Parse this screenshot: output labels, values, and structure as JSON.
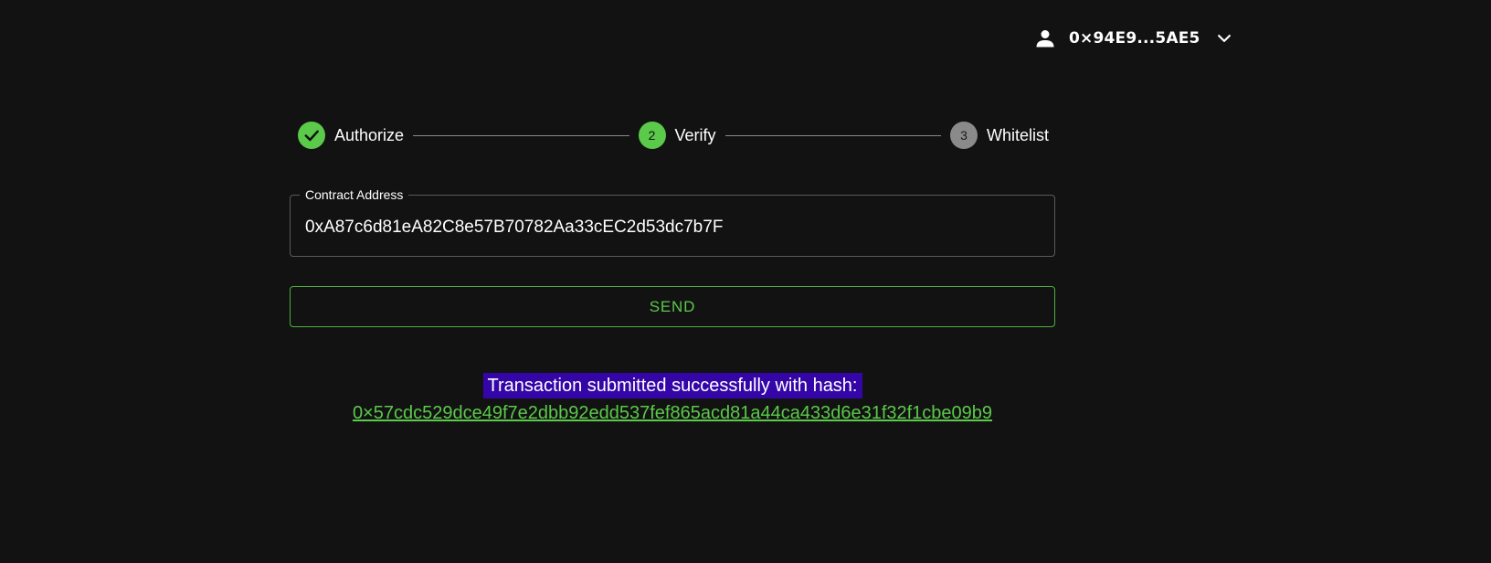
{
  "account": {
    "address": "0×94E9...5AE5",
    "user_icon": "user-icon",
    "dropdown_icon": "chevron-down-icon"
  },
  "stepper": {
    "steps": [
      {
        "label": "Authorize",
        "state": "done",
        "indicator": "check-icon"
      },
      {
        "label": "Verify",
        "state": "active",
        "number": "2"
      },
      {
        "label": "Whitelist",
        "state": "pending",
        "number": "3"
      }
    ]
  },
  "form": {
    "contract_label": "Contract Address",
    "contract_value": "0xA87c6d81eA82C8e57B70782Aa33cEC2d53dc7b7F",
    "send_label": "SEND"
  },
  "result": {
    "message": "Transaction submitted successfully with hash:",
    "hash": "0×57cdc529dce49f7e2dbb92edd537fef865acd81a44ca433d6e31f32f1cbe09b9"
  },
  "colors": {
    "background": "#121212",
    "accent": "#5bc94a",
    "pending": "#8a8a8a",
    "highlight": "#3406a8"
  }
}
